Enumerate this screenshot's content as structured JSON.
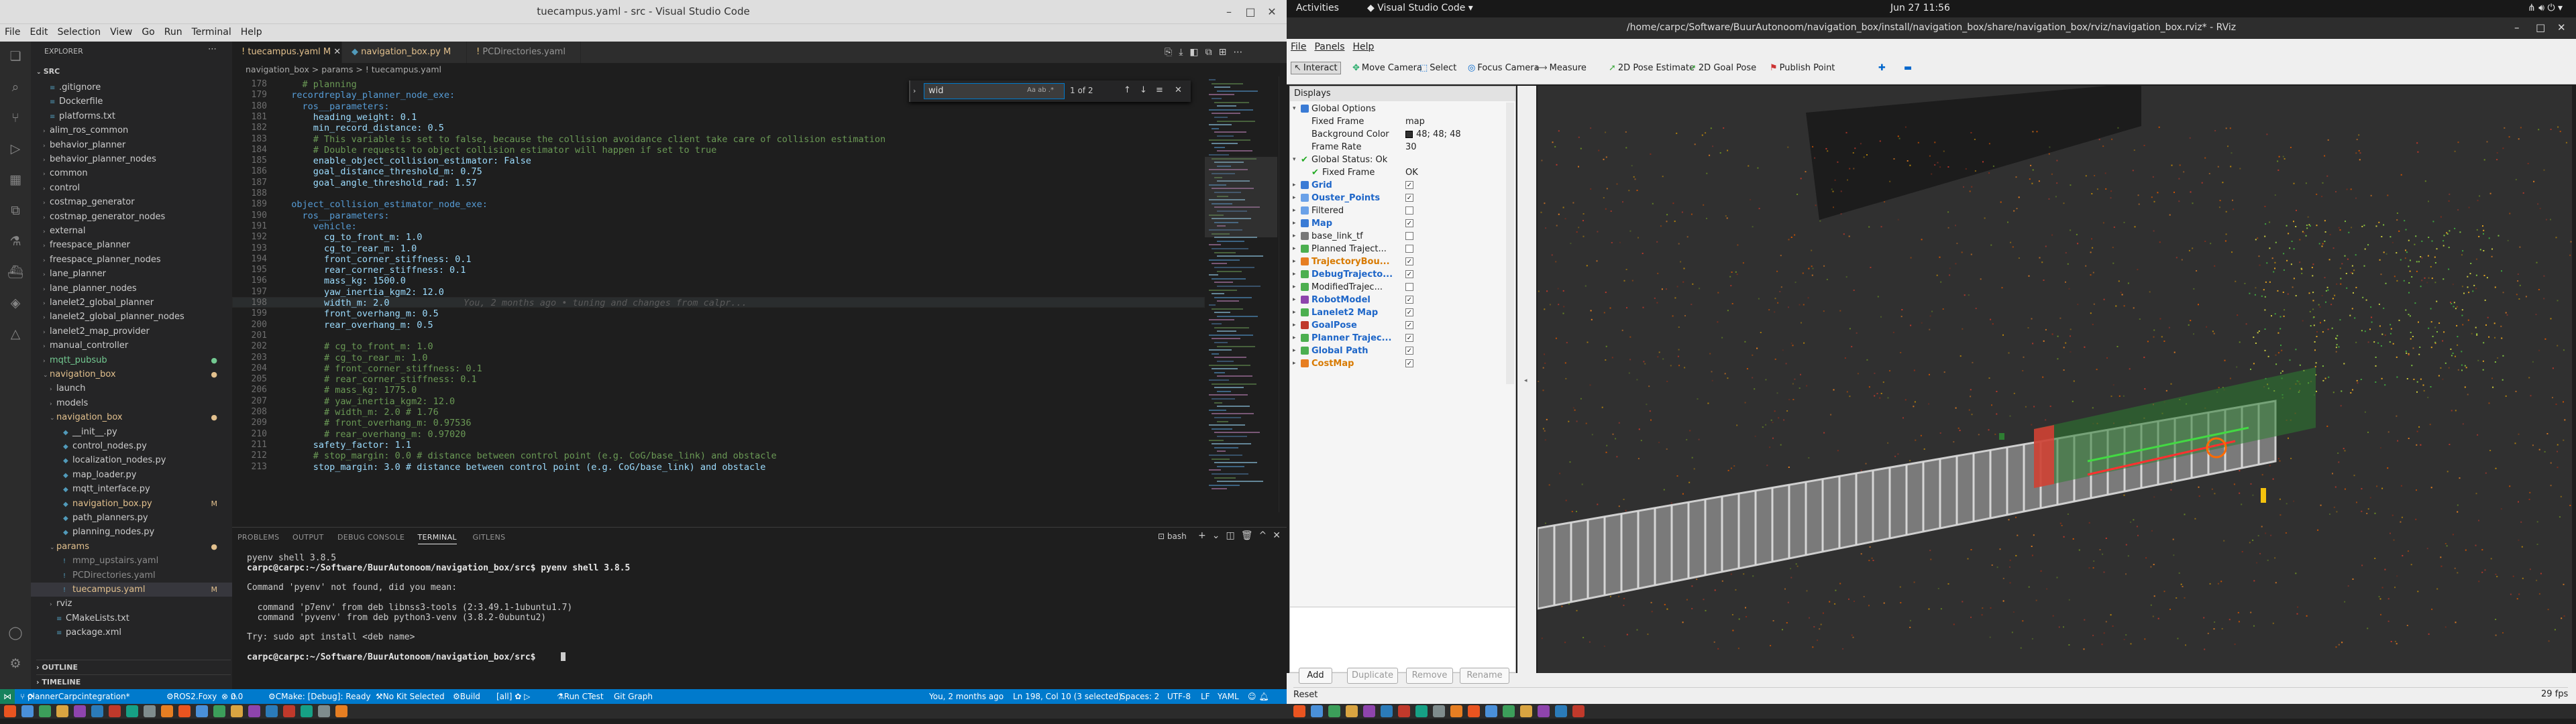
{
  "vscode": {
    "title": "tuecampus.yaml - src - Visual Studio Code",
    "menu": [
      "File",
      "Edit",
      "Selection",
      "View",
      "Go",
      "Run",
      "Terminal",
      "Help"
    ],
    "explorer": {
      "header": "EXPLORER",
      "root": "SRC",
      "items": [
        {
          "label": ".gitignore",
          "depth": 1,
          "kind": "file"
        },
        {
          "label": "Dockerfile",
          "depth": 1,
          "kind": "file"
        },
        {
          "label": "platforms.txt",
          "depth": 1,
          "kind": "file"
        },
        {
          "label": "alim_ros_common",
          "depth": 1,
          "kind": "folder"
        },
        {
          "label": "behavior_planner",
          "depth": 1,
          "kind": "folder"
        },
        {
          "label": "behavior_planner_nodes",
          "depth": 1,
          "kind": "folder"
        },
        {
          "label": "common",
          "depth": 1,
          "kind": "folder"
        },
        {
          "label": "control",
          "depth": 1,
          "kind": "folder"
        },
        {
          "label": "costmap_generator",
          "depth": 1,
          "kind": "folder"
        },
        {
          "label": "costmap_generator_nodes",
          "depth": 1,
          "kind": "folder"
        },
        {
          "label": "external",
          "depth": 1,
          "kind": "folder"
        },
        {
          "label": "freespace_planner",
          "depth": 1,
          "kind": "folder"
        },
        {
          "label": "freespace_planner_nodes",
          "depth": 1,
          "kind": "folder"
        },
        {
          "label": "lane_planner",
          "depth": 1,
          "kind": "folder"
        },
        {
          "label": "lane_planner_nodes",
          "depth": 1,
          "kind": "folder"
        },
        {
          "label": "lanelet2_global_planner",
          "depth": 1,
          "kind": "folder"
        },
        {
          "label": "lanelet2_global_planner_nodes",
          "depth": 1,
          "kind": "folder"
        },
        {
          "label": "lanelet2_map_provider",
          "depth": 1,
          "kind": "folder"
        },
        {
          "label": "manual_controller",
          "depth": 1,
          "kind": "folder"
        },
        {
          "label": "mqtt_pubsub",
          "depth": 1,
          "kind": "folder",
          "color": "#73c991"
        },
        {
          "label": "navigation_box",
          "depth": 1,
          "kind": "open",
          "color": "#e2c08d"
        },
        {
          "label": "launch",
          "depth": 2,
          "kind": "folder"
        },
        {
          "label": "models",
          "depth": 2,
          "kind": "folder"
        },
        {
          "label": "navigation_box",
          "depth": 2,
          "kind": "open",
          "color": "#e2c08d"
        },
        {
          "label": "__init__.py",
          "depth": 3,
          "kind": "file"
        },
        {
          "label": "control_nodes.py",
          "depth": 3,
          "kind": "file"
        },
        {
          "label": "localization_nodes.py",
          "depth": 3,
          "kind": "file"
        },
        {
          "label": "map_loader.py",
          "depth": 3,
          "kind": "file"
        },
        {
          "label": "mqtt_interface.py",
          "depth": 3,
          "kind": "file"
        },
        {
          "label": "navigation_box.py",
          "depth": 3,
          "kind": "file",
          "color": "#e2c08d",
          "mod": "M"
        },
        {
          "label": "path_planners.py",
          "depth": 3,
          "kind": "file"
        },
        {
          "label": "planning_nodes.py",
          "depth": 3,
          "kind": "file"
        },
        {
          "label": "params",
          "depth": 2,
          "kind": "open",
          "color": "#e2c08d"
        },
        {
          "label": "mmp_upstairs.yaml",
          "depth": 3,
          "kind": "file",
          "color": "#8c8c8c"
        },
        {
          "label": "PCDirectories.yaml",
          "depth": 3,
          "kind": "file",
          "color": "#8c8c8c"
        },
        {
          "label": "tuecampus.yaml",
          "depth": 3,
          "kind": "file",
          "color": "#e2c08d",
          "mod": "M",
          "active": true
        },
        {
          "label": "rviz",
          "depth": 2,
          "kind": "folder"
        },
        {
          "label": "CMakeLists.txt",
          "depth": 2,
          "kind": "file"
        },
        {
          "label": "package.xml",
          "depth": 2,
          "kind": "file"
        }
      ],
      "outline": "OUTLINE",
      "timeline": "TIMELINE"
    },
    "tabs": [
      {
        "label": "tuecampus.yaml M",
        "active": true
      },
      {
        "label": "navigation_box.py M",
        "active": false
      },
      {
        "label": "PCDirectories.yaml",
        "active": false
      }
    ],
    "breadcrumb": "navigation_box > params > ! tuecampus.yaml",
    "find": {
      "value": "wid",
      "status": "1 of 2"
    },
    "code_lines": [
      {
        "n": "178",
        "t": "    # planning"
      },
      {
        "n": "179",
        "t": "  recordreplay_planner_node_exe:"
      },
      {
        "n": "180",
        "t": "    ros__parameters:"
      },
      {
        "n": "181",
        "t": "      heading_weight: 0.1"
      },
      {
        "n": "182",
        "t": "      min_record_distance: 0.5"
      },
      {
        "n": "183",
        "t": "      # This variable is set to false, because the collision avoidance client take care of collision estimation"
      },
      {
        "n": "184",
        "t": "      # Double requests to object collision estimator will happen if set to true"
      },
      {
        "n": "185",
        "t": "      enable_object_collision_estimator: False"
      },
      {
        "n": "186",
        "t": "      goal_distance_threshold_m: 0.75"
      },
      {
        "n": "187",
        "t": "      goal_angle_threshold_rad: 1.57"
      },
      {
        "n": "188",
        "t": ""
      },
      {
        "n": "189",
        "t": "  object_collision_estimator_node_exe:"
      },
      {
        "n": "190",
        "t": "    ros__parameters:"
      },
      {
        "n": "191",
        "t": "      vehicle:"
      },
      {
        "n": "192",
        "t": "        cg_to_front_m: 1.0"
      },
      {
        "n": "193",
        "t": "        cg_to_rear_m: 1.0"
      },
      {
        "n": "194",
        "t": "        front_corner_stiffness: 0.1"
      },
      {
        "n": "195",
        "t": "        rear_corner_stiffness: 0.1"
      },
      {
        "n": "196",
        "t": "        mass_kg: 1500.0"
      },
      {
        "n": "197",
        "t": "        yaw_inertia_kgm2: 12.0"
      },
      {
        "n": "198",
        "t": "        width_m: 2.0",
        "hint": "You, 2 months ago • tuning and changes from calpr..."
      },
      {
        "n": "199",
        "t": "        front_overhang_m: 0.5"
      },
      {
        "n": "200",
        "t": "        rear_overhang_m: 0.5"
      },
      {
        "n": "201",
        "t": ""
      },
      {
        "n": "202",
        "t": "        # cg_to_front_m: 1.0"
      },
      {
        "n": "203",
        "t": "        # cg_to_rear_m: 1.0"
      },
      {
        "n": "204",
        "t": "        # front_corner_stiffness: 0.1"
      },
      {
        "n": "205",
        "t": "        # rear_corner_stiffness: 0.1"
      },
      {
        "n": "206",
        "t": "        # mass_kg: 1775.0"
      },
      {
        "n": "207",
        "t": "        # yaw_inertia_kgm2: 12.0"
      },
      {
        "n": "208",
        "t": "        # width_m: 2.0 # 1.76"
      },
      {
        "n": "209",
        "t": "        # front_overhang_m: 0.97536"
      },
      {
        "n": "210",
        "t": "        # rear_overhang_m: 0.97020"
      },
      {
        "n": "211",
        "t": "      safety_factor: 1.1"
      },
      {
        "n": "212",
        "t": "      # stop_margin: 0.0 # distance between control point (e.g. CoG/base_link) and obstacle"
      },
      {
        "n": "213",
        "t": "      stop_margin: 3.0 # distance between control point (e.g. CoG/base_link) and obstacle"
      }
    ],
    "panel_tabs": [
      "PROBLEMS",
      "OUTPUT",
      "DEBUG CONSOLE",
      "TERMINAL",
      "GITLENS"
    ],
    "terminal_shell": "bash",
    "terminal": [
      "pyenv shell 3.8.5",
      "carpc@carpc:~/Software/BuurAutonoom/navigation_box/src$ pyenv shell 3.8.5",
      "",
      "Command 'pyenv' not found, did you mean:",
      "",
      "  command 'p7env' from deb libnss3-tools (2:3.49.1-1ubuntu1.7)",
      "  command 'pyvenv' from deb python3-venv (3.8.2-0ubuntu2)",
      "",
      "Try: sudo apt install <deb name>",
      "",
      "carpc@carpc:~/Software/BuurAutonoom/navigation_box/src$ "
    ],
    "status": {
      "branch": "plannerCarpcintegration*",
      "ros": "ROS2.Foxy",
      "errors": "0",
      "warnings": "0",
      "cmake": "CMake: [Debug]: Ready",
      "kit": "No Kit Selected",
      "build": "Build",
      "ctest": "Run CTest",
      "git": "Git Graph",
      "blame": "You, 2 months ago",
      "pos": "Ln 198, Col 10 (3 selected)",
      "spaces": "Spaces: 2",
      "enc": "UTF-8",
      "eol": "LF",
      "lang": "YAML"
    }
  },
  "gnome": {
    "activities": "Activities",
    "app": "Visual Studio Code",
    "clock": "Jun 27  11:56"
  },
  "rviz": {
    "title": "/home/carpc/Software/BuurAutonoom/navigation_box/install/navigation_box/share/navigation_box/rviz/navigation_box.rviz* - RViz",
    "menu": [
      "File",
      "Panels",
      "Help"
    ],
    "tools": [
      "Interact",
      "Move Camera",
      "Select",
      "Focus Camera",
      "Measure",
      "2D Pose Estimate",
      "2D Goal Pose",
      "Publish Point"
    ],
    "displays_header": "Displays",
    "rows": [
      {
        "name": "Global Options",
        "depth": 0,
        "icon": "#3a7bd5",
        "expand": "open"
      },
      {
        "name": "Fixed Frame",
        "depth": 1,
        "value": "map"
      },
      {
        "name": "Background Color",
        "depth": 1,
        "value": "48; 48; 48",
        "swatch": "#303030"
      },
      {
        "name": "Frame Rate",
        "depth": 1,
        "value": "30"
      },
      {
        "name": "Global Status: Ok",
        "depth": 0,
        "icon": "check",
        "expand": "open"
      },
      {
        "name": "Fixed Frame",
        "depth": 1,
        "value": "OK",
        "icon": "check"
      },
      {
        "name": "Grid",
        "depth": 0,
        "icon": "#3a7bd5",
        "style": "blue",
        "check": true
      },
      {
        "name": "Ouster_Points",
        "depth": 0,
        "icon": "#6aa1e8",
        "style": "blue",
        "check": true
      },
      {
        "name": "Filtered",
        "depth": 0,
        "icon": "#6aa1e8",
        "check": false
      },
      {
        "name": "Map",
        "depth": 0,
        "icon": "#3a7bd5",
        "style": "blue",
        "check": true
      },
      {
        "name": "base_link_tf",
        "depth": 0,
        "icon": "#777777",
        "check": false
      },
      {
        "name": "Planned Traject...",
        "depth": 0,
        "icon": "#4caf50",
        "check": false
      },
      {
        "name": "TrajectoryBou...",
        "depth": 0,
        "icon": "#e67e22",
        "style": "orange",
        "check": true
      },
      {
        "name": "DebugTrajecto...",
        "depth": 0,
        "icon": "#4caf50",
        "style": "blue",
        "check": true
      },
      {
        "name": "ModifiedTrajec...",
        "depth": 0,
        "icon": "#4caf50",
        "check": false
      },
      {
        "name": "RobotModel",
        "depth": 0,
        "icon": "#8e44ad",
        "style": "blue",
        "check": true
      },
      {
        "name": "Lanelet2 Map",
        "depth": 0,
        "icon": "#4caf50",
        "style": "blue",
        "check": true
      },
      {
        "name": "GoalPose",
        "depth": 0,
        "icon": "#c0392b",
        "style": "blue",
        "check": true
      },
      {
        "name": "Planner Trajec...",
        "depth": 0,
        "icon": "#4caf50",
        "style": "blue",
        "check": true
      },
      {
        "name": "Global Path",
        "depth": 0,
        "icon": "#4caf50",
        "style": "blue",
        "check": true
      },
      {
        "name": "CostMap",
        "depth": 0,
        "icon": "#e67e22",
        "style": "orange",
        "check": true
      }
    ],
    "buttons": [
      "Add",
      "Duplicate",
      "Remove",
      "Rename"
    ],
    "reset": "Reset",
    "fps": "29 fps"
  }
}
